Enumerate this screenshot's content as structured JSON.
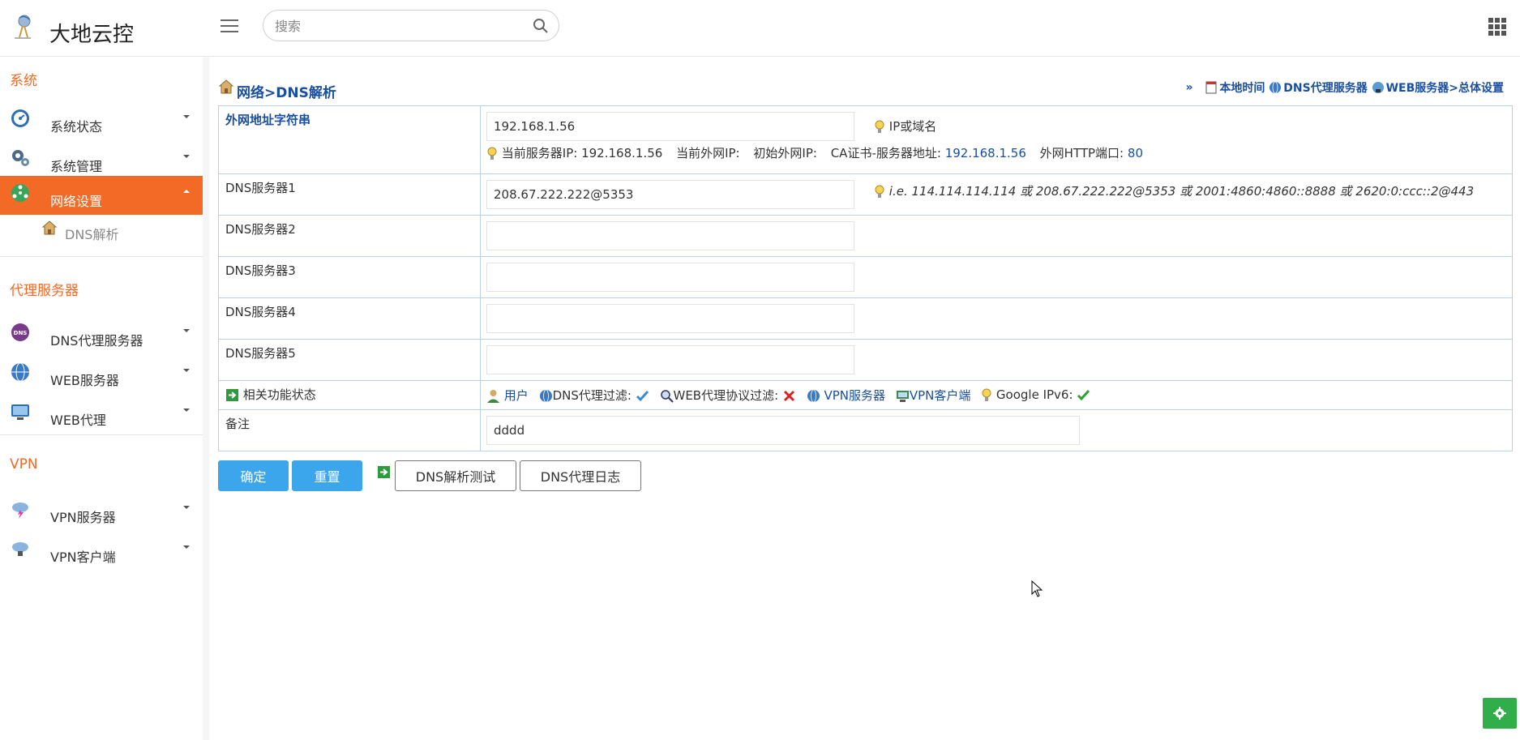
{
  "header": {
    "app_title": "大地云控",
    "search_placeholder": "搜索"
  },
  "sidebar": {
    "sections": [
      {
        "title": "系统"
      },
      {
        "title": "代理服务器"
      },
      {
        "title": "VPN"
      }
    ],
    "items": [
      {
        "label": "系统状态",
        "icon": "dashboard-icon"
      },
      {
        "label": "系统管理",
        "icon": "gears-icon"
      },
      {
        "label": "网络设置",
        "icon": "network-icon",
        "active": true
      },
      {
        "label": "DNS代理服务器",
        "icon": "dns-icon"
      },
      {
        "label": "WEB服务器",
        "icon": "www-icon"
      },
      {
        "label": "WEB代理",
        "icon": "proxy-icon"
      },
      {
        "label": "VPN服务器",
        "icon": "cloud-lightning-icon"
      },
      {
        "label": "VPN客户端",
        "icon": "cloud-client-icon"
      }
    ],
    "sub_item": {
      "label": "DNS解析",
      "icon": "house-icon"
    }
  },
  "main": {
    "breadcrumb": "网络>DNS解析",
    "quick_links": {
      "prefix": "»",
      "local_time": "本地时间",
      "dns_proxy": "DNS代理服务器",
      "web_server": "WEB服务器>总体设置"
    },
    "form": {
      "wan_label": "外网地址字符串",
      "wan_value": "192.168.1.56",
      "wan_hint": "IP或域名",
      "status": {
        "server_ip_label": "当前服务器IP:",
        "server_ip": "192.168.1.56",
        "wan_ip_label": "当前外网IP:",
        "init_wan_ip_label": "初始外网IP:",
        "ca_label": "CA证书-服务器地址:",
        "ca_value": "192.168.1.56",
        "http_port_label": "外网HTTP端口:",
        "http_port": "80"
      },
      "dns1_label": "DNS服务器1",
      "dns1_value": "208.67.222.222@5353",
      "dns_hint": "i.e. 114.114.114.114 或 208.67.222.222@5353 或 2001:4860:4860::8888 或 2620:0:ccc::2@443",
      "dns2_label": "DNS服务器2",
      "dns2_value": "",
      "dns3_label": "DNS服务器3",
      "dns3_value": "",
      "dns4_label": "DNS服务器4",
      "dns4_value": "",
      "dns5_label": "DNS服务器5",
      "dns5_value": "",
      "related_label": "相关功能状态",
      "related": {
        "user": "用户",
        "dns_filter": "DNS代理过滤:",
        "web_filter": "WEB代理协议过滤:",
        "vpn_server": "VPN服务器",
        "vpn_client": "VPN客户端",
        "google_ipv6": "Google IPv6:"
      },
      "remark_label": "备注",
      "remark_value": "dddd"
    },
    "buttons": {
      "confirm": "确定",
      "reset": "重置",
      "dns_test": "DNS解析测试",
      "dns_log": "DNS代理日志"
    }
  },
  "colors": {
    "accent": "#f26a26",
    "link": "#1a4fa0",
    "primary_button": "#3ba6ec",
    "table_border": "#b8d0e8",
    "settings_fab": "#2fae4a"
  }
}
